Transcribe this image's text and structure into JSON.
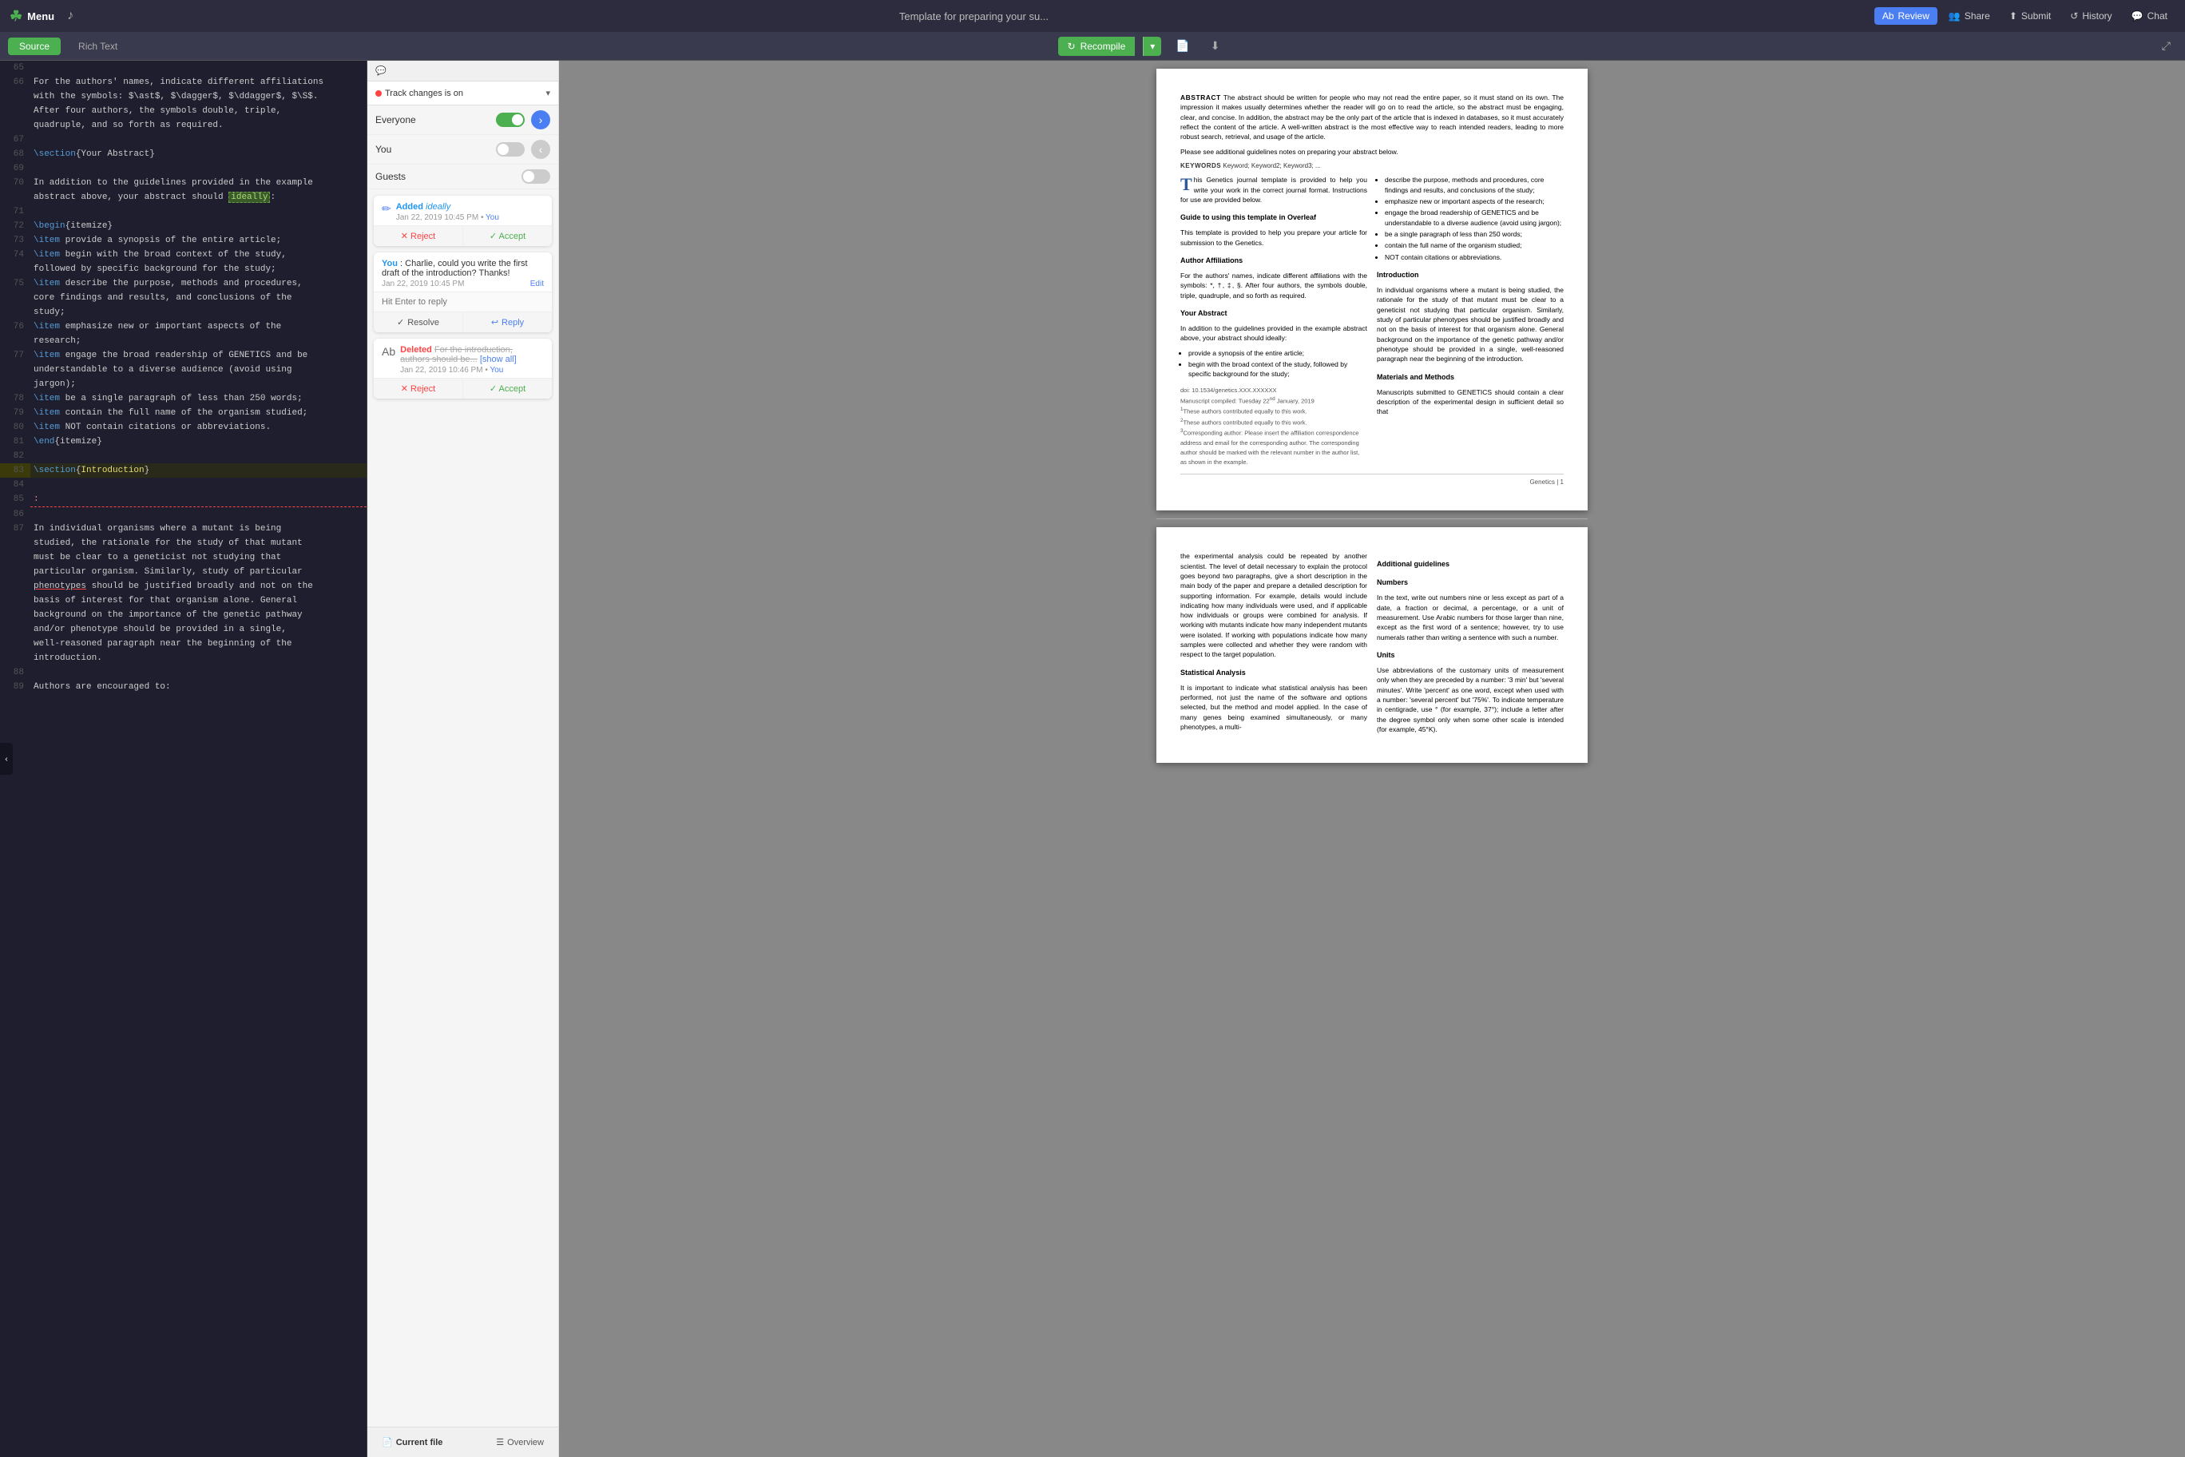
{
  "topbar": {
    "logo": "☘",
    "logo_label": "Menu",
    "tune_icon": "♪",
    "title": "Template for preparing your su...",
    "review_label": "Review",
    "share_label": "Share",
    "submit_label": "Submit",
    "history_label": "History",
    "chat_label": "Chat"
  },
  "secondbar": {
    "source_label": "Source",
    "richtext_label": "Rich Text",
    "recompile_label": "Recompile",
    "expand_icon": "⤢",
    "doc_icon": "📄",
    "download_icon": "⬇",
    "fullscreen_icon": "⛶"
  },
  "source": {
    "lines": [
      {
        "num": "65",
        "content": ""
      },
      {
        "num": "66",
        "content": "For the authors' names, indicate different affiliations\nwith the symbols: $\\ast$, $\\dagger$, $\\ddagger$, $\\S$.\nAfter four authors, the symbols double, triple,\nquadruple, and so forth as required."
      },
      {
        "num": "67",
        "content": ""
      },
      {
        "num": "68",
        "content": "\\section{Your Abstract}"
      },
      {
        "num": "69",
        "content": ""
      },
      {
        "num": "70",
        "content": "In addition to the guidelines provided in the example\nabstract above, your abstract should ideally:"
      },
      {
        "num": "71",
        "content": ""
      },
      {
        "num": "72",
        "content": "\\begin{itemize}"
      },
      {
        "num": "73",
        "content": "\\item provide a synopsis of the entire article;"
      },
      {
        "num": "74",
        "content": "\\item begin with the broad context of the study,\nfollowed by specific background for the study;"
      },
      {
        "num": "75",
        "content": "\\item describe the purpose, methods and procedures,\ncore findings and results, and conclusions of the\nstudy;"
      },
      {
        "num": "76",
        "content": "\\item emphasize new or important aspects of the\nresearch;"
      },
      {
        "num": "77",
        "content": "\\item engage the broad readership of GENETICS and be\nunderstandable to a diverse audience (avoid using\njargon);"
      },
      {
        "num": "78",
        "content": "\\item be a single paragraph of less than 250 words;"
      },
      {
        "num": "79",
        "content": "\\item contain the full name of the organism studied;"
      },
      {
        "num": "80",
        "content": "\\item NOT contain citations or abbreviations."
      },
      {
        "num": "81",
        "content": "\\end{itemize}"
      },
      {
        "num": "82",
        "content": ""
      },
      {
        "num": "83",
        "content": "\\section{Introduction}"
      },
      {
        "num": "84",
        "content": ""
      },
      {
        "num": "85",
        "content": ":"
      },
      {
        "num": "86",
        "content": ""
      },
      {
        "num": "87",
        "content": "In individual organisms where a mutant is being\nstudied, the rationale for the study of that mutant\nmust be clear to a geneticist not studying that\nparticular organism. Similarly, study of particular\nphenotypes should be justified broadly and not on the\nbasis of interest for that organism alone. General\nbackground on the importance of the genetic pathway\nand/or phenotype should be provided in a single,\nwell-reasoned paragraph near the beginning of the\nintroduction."
      },
      {
        "num": "88",
        "content": ""
      },
      {
        "num": "89",
        "content": "Authors are encouraged to:"
      }
    ]
  },
  "track_changes": {
    "label": "Track changes is on",
    "status": "on",
    "everyone_label": "Everyone",
    "you_label": "You",
    "guests_label": "Guests",
    "everyone_on": true,
    "you_on": false,
    "guests_on": false
  },
  "change_card_1": {
    "action": "Added",
    "word": "ideally",
    "date": "Jan 22, 2019 10:45 PM",
    "author": "You",
    "reject_label": "✕ Reject",
    "accept_label": "✓ Accept"
  },
  "reply_card": {
    "author": "You",
    "text": "Charlie, could you write the first draft of the introduction? Thanks!",
    "date": "Jan 22, 2019 10:45 PM",
    "edit_label": "Edit",
    "placeholder": "Hit Enter to reply",
    "resolve_label": "Resolve",
    "reply_label": "Reply"
  },
  "change_card_2": {
    "action": "Deleted",
    "deleted_text": "For the introduction, authors should be...",
    "show_all": "[show all]",
    "date": "Jan 22, 2019 10:46 PM",
    "author": "You",
    "reject_label": "✕ Reject",
    "accept_label": "✓ Accept"
  },
  "nav": {
    "current_file": "Current file",
    "overview": "Overview",
    "current_icon": "📄",
    "overview_icon": "☰"
  },
  "preview": {
    "abstract_label": "ABSTRACT",
    "abstract_text": "The abstract should be written for people who may not read the entire paper, so it must stand on its own. The impression it makes usually determines whether the reader will go on to read the article, so the abstract must be engaging, clear, and concise. In addition, the abstract may be the only part of the article that is indexed in databases, so it must accurately reflect the content of the article. A well-written abstract is the most effective way to reach intended readers, leading to more robust search, retrieval, and usage of the article.",
    "abstract_extra": "Please see additional guidelines notes on preparing your abstract below.",
    "keywords_label": "KEYWORDS",
    "keywords_text": "Keyword; Keyword2; Keyword3; ...",
    "drop_cap": "T",
    "drop_cap_rest": "his Genetics journal template is provided to help you write your work in the correct journal format. Instructions for use are provided below.",
    "guide_title": "Guide to using this template in Overleaf",
    "guide_text": "This template is provided to help you prepare your article for submission to the Genetics.",
    "affiliations_title": "Author Affiliations",
    "affiliations_text": "For the authors' names, indicate different affiliations with the symbols: *, †, ‡, §. After four authors, the symbols double, triple, quadruple, and so forth as required.",
    "abstract_section_title": "Your Abstract",
    "abstract_section_text": "In addition to the guidelines provided in the example abstract above, your abstract should ideally:",
    "bullets_left": [
      "provide a synopsis of the entire article;",
      "begin with the broad context of the study, followed by specific background for the study;"
    ],
    "doi_text": "doi: 10.1534/genetics.XXX.XXXXXX\nManuscript compiled: Tuesday 22nd January, 2019\n¹These authors contributed equally to this work.\n²These authors contributed equally to this work.\n³Corresponding author: Please insert the affiliation correspondence address and email for the corresponding author. The corresponding author should be marked with the relevant number in the author list, as shown in the example.",
    "bullets_right": [
      "describe the purpose, methods and procedures, core findings and results, and conclusions of the study;",
      "emphasize new or important aspects of the research;",
      "engage the broad readership of GENETICS and be understandable to a diverse audience (avoid using jargon);",
      "be a single paragraph of less than 250 words;",
      "contain the full name of the organism studied;",
      "NOT contain citations or abbreviations."
    ],
    "intro_title": "Introduction",
    "intro_text": "In individual organisms where a mutant is being studied, the rationale for the study of that mutant must be clear to a geneticist not studying that particular organism. Similarly, study of particular phenotypes should be justified broadly and not on the basis of interest for that organism alone. General background on the importance of the genetic pathway and/or phenotype should be provided in a single, well-reasoned paragraph near the beginning of the introduction.",
    "intro_extra": "Authors are encouraged to:",
    "page2_title": "Additional guidelines",
    "numbers_title": "Numbers",
    "numbers_text": "In the text, write out numbers nine or less except as part of a date, a fraction or decimal, a percentage, or a unit of measurement. Use Arabic numbers for those larger than nine, except as the first word of a sentence; however, try to use numerals rather than writing a sentence with such a number.",
    "units_title": "Units",
    "units_text": "Use abbreviations of the customary units of measurement only when they are preceded by a number: '3 min' but 'several minutes'. Write 'percent' as one word, except when used with a number: 'several percent' but '75%'. To indicate temperature in centigrade, use ° (for example, 37°); include a letter after the degree symbol only when some other scale is intended (for example, 45°K).",
    "materials_title": "Materials and Methods",
    "materials_text": "Manuscripts submitted to GENETICS should contain a clear description of the experimental design in sufficient detail so that",
    "page2_left": "the experimental analysis could be repeated by another scientist. The level of detail necessary to explain the protocol goes beyond two paragraphs, give a short description in the main body of the paper and prepare a detailed description for supporting information. For example, details would include indicating how many individuals were used, and if applicable how individuals or groups were combined for analysis. If working with mutants indicate how many independent mutants were isolated. If working with populations indicate how many samples were collected and whether they were random with respect to the target population.",
    "statistical_title": "Statistical Analysis",
    "statistical_text": "It is important to indicate what statistical analysis has been performed, not just the name of the software and options selected, but the method and model applied. In the case of many genes being examined simultaneously, or many phenotypes, a multi-",
    "page_num": "Genetics | 1"
  }
}
